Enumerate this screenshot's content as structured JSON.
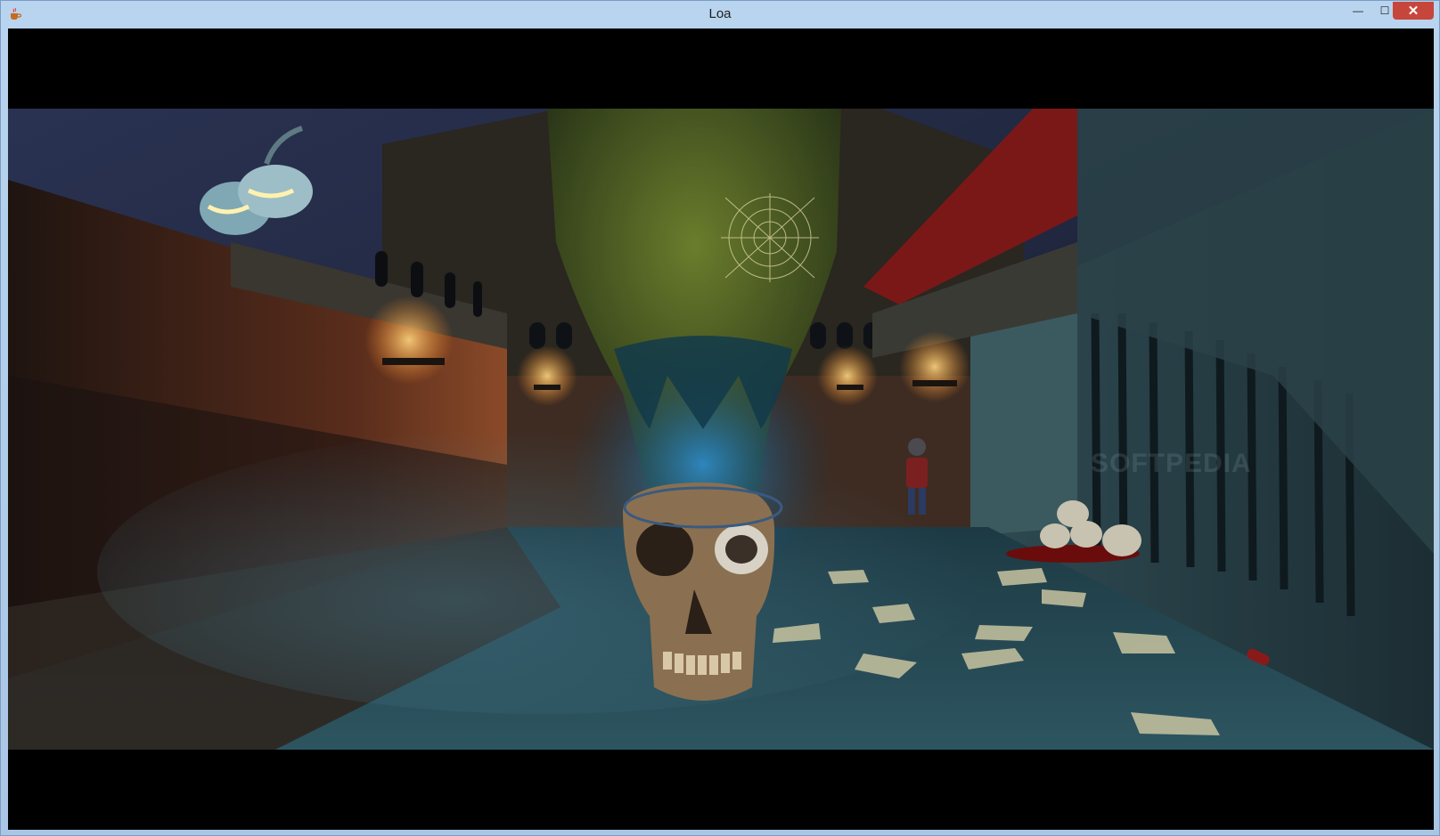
{
  "window": {
    "title": "Loa",
    "icon": "java-cup-icon",
    "controls": {
      "minimize": "—",
      "maximize": "☐",
      "close": "✕"
    }
  },
  "scene": {
    "watermark": "SOFTPEDIA"
  },
  "colors": {
    "titlebar": "#aecbe8",
    "close_button": "#c7463b",
    "letterbox": "#000000"
  }
}
